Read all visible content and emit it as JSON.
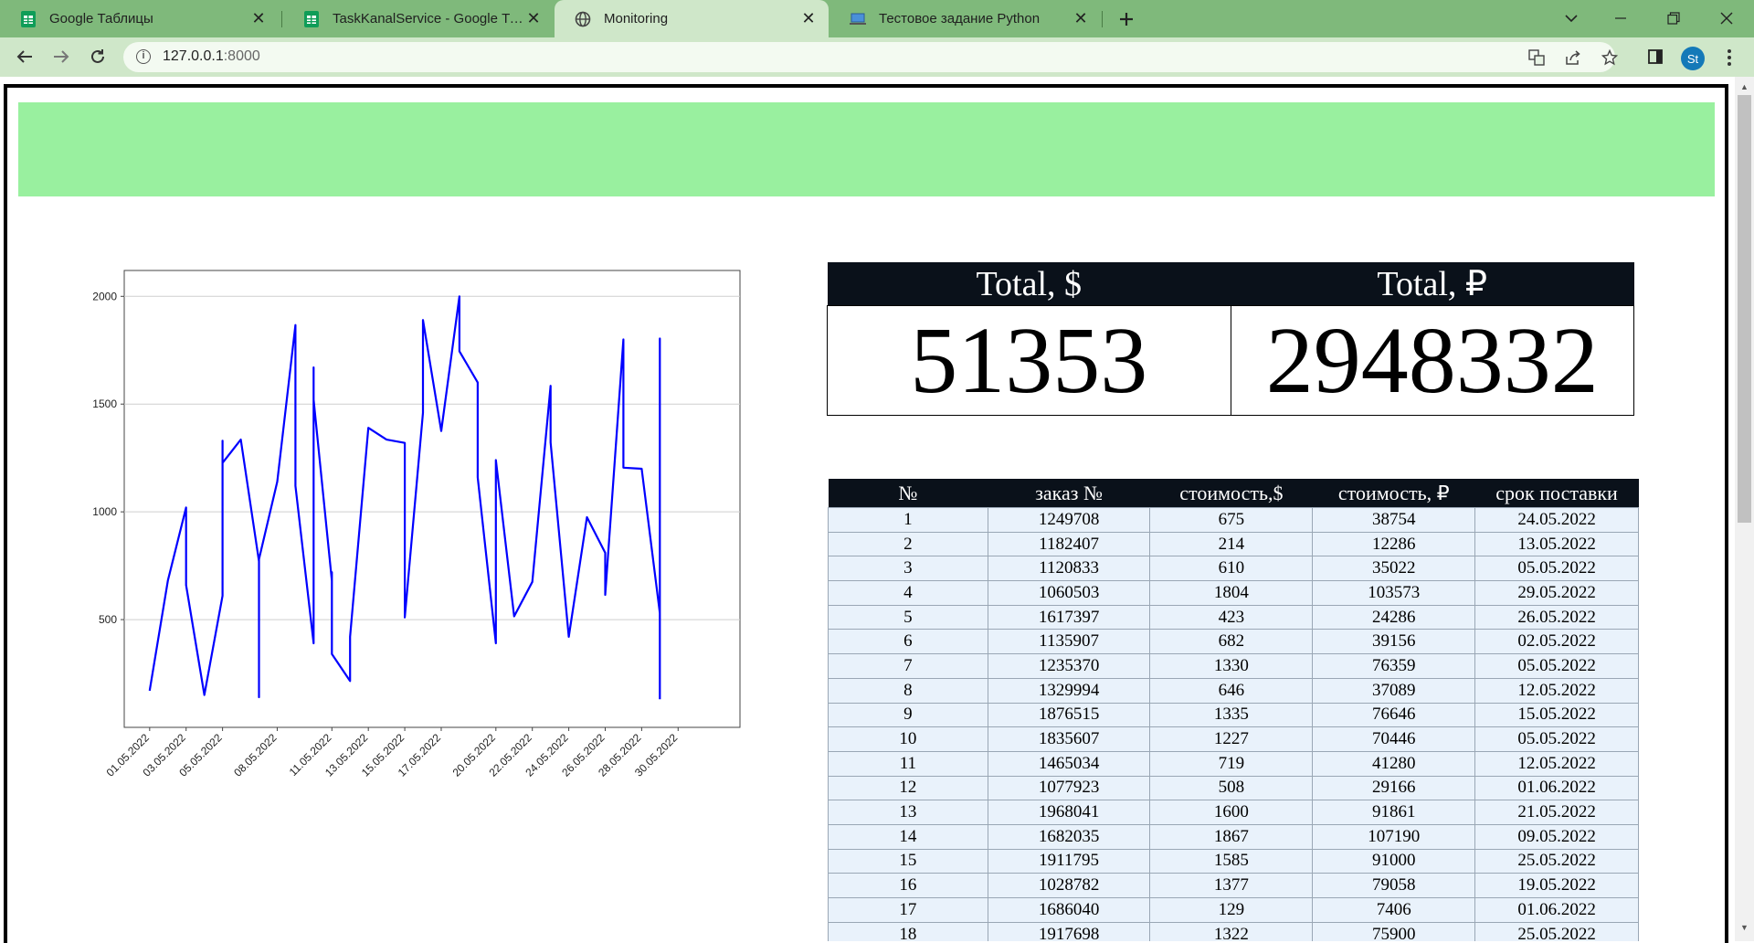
{
  "browser": {
    "tabs": [
      {
        "title": "Google Таблицы",
        "icon": "google-sheets-icon",
        "active": false
      },
      {
        "title": "TaskKanalService - Google Табли",
        "icon": "google-sheets-icon",
        "active": false
      },
      {
        "title": "Monitoring",
        "icon": "globe-icon",
        "active": true
      },
      {
        "title": "Тестовое задание Python",
        "icon": "laptop-icon",
        "active": false
      }
    ],
    "close_glyph": "✕",
    "address": {
      "host": "127.0.0.1",
      "port": ":8000"
    },
    "profile_initials": "St"
  },
  "totals": {
    "usd_label": "Total, $",
    "rub_label": "Total, ₽",
    "usd_value": "51353",
    "rub_value": "2948332"
  },
  "orders": {
    "headers": [
      "№",
      "заказ №",
      "стоимость,$",
      "стоимость, ₽",
      "срок поставки"
    ],
    "rows": [
      [
        "1",
        "1249708",
        "675",
        "38754",
        "24.05.2022"
      ],
      [
        "2",
        "1182407",
        "214",
        "12286",
        "13.05.2022"
      ],
      [
        "3",
        "1120833",
        "610",
        "35022",
        "05.05.2022"
      ],
      [
        "4",
        "1060503",
        "1804",
        "103573",
        "29.05.2022"
      ],
      [
        "5",
        "1617397",
        "423",
        "24286",
        "26.05.2022"
      ],
      [
        "6",
        "1135907",
        "682",
        "39156",
        "02.05.2022"
      ],
      [
        "7",
        "1235370",
        "1330",
        "76359",
        "05.05.2022"
      ],
      [
        "8",
        "1329994",
        "646",
        "37089",
        "12.05.2022"
      ],
      [
        "9",
        "1876515",
        "1335",
        "76646",
        "15.05.2022"
      ],
      [
        "10",
        "1835607",
        "1227",
        "70446",
        "05.05.2022"
      ],
      [
        "11",
        "1465034",
        "719",
        "41280",
        "12.05.2022"
      ],
      [
        "12",
        "1077923",
        "508",
        "29166",
        "01.06.2022"
      ],
      [
        "13",
        "1968041",
        "1600",
        "91861",
        "21.05.2022"
      ],
      [
        "14",
        "1682035",
        "1867",
        "107190",
        "09.05.2022"
      ],
      [
        "15",
        "1911795",
        "1585",
        "91000",
        "25.05.2022"
      ],
      [
        "16",
        "1028782",
        "1377",
        "79058",
        "19.05.2022"
      ],
      [
        "17",
        "1686040",
        "129",
        "7406",
        "01.06.2022"
      ],
      [
        "18",
        "1917698",
        "1322",
        "75900",
        "25.05.2022"
      ]
    ]
  },
  "chart_data": {
    "type": "line",
    "color": "#0000ff",
    "title": "",
    "xlabel": "",
    "ylabel": "",
    "grid": "horizontal",
    "x_range": [
      "01.05.2022",
      "01.06.2022"
    ],
    "ylim": [
      0,
      2000
    ],
    "yticks": [
      500,
      1000,
      1500,
      2000
    ],
    "xticks": [
      "01.05.2022",
      "03.05.2022",
      "05.05.2022",
      "08.05.2022",
      "11.05.2022",
      "13.05.2022",
      "15.05.2022",
      "17.05.2022",
      "20.05.2022",
      "22.05.2022",
      "24.05.2022",
      "26.05.2022",
      "28.05.2022",
      "30.05.2022"
    ],
    "points": [
      [
        "01.05.2022",
        170
      ],
      [
        "02.05.2022",
        682
      ],
      [
        "03.05.2022",
        1020
      ],
      [
        "03.05.2022",
        660
      ],
      [
        "04.05.2022",
        150
      ],
      [
        "05.05.2022",
        610
      ],
      [
        "05.05.2022",
        1330
      ],
      [
        "05.05.2022",
        1227
      ],
      [
        "06.05.2022",
        1335
      ],
      [
        "07.05.2022",
        770
      ],
      [
        "07.05.2022",
        140
      ],
      [
        "07.05.2022",
        780
      ],
      [
        "08.05.2022",
        1140
      ],
      [
        "09.05.2022",
        1867
      ],
      [
        "09.05.2022",
        1120
      ],
      [
        "10.05.2022",
        390
      ],
      [
        "10.05.2022",
        1670
      ],
      [
        "10.05.2022",
        1520
      ],
      [
        "11.05.2022",
        680
      ],
      [
        "11.05.2022",
        720
      ],
      [
        "11.05.2022",
        340
      ],
      [
        "12.05.2022",
        215
      ],
      [
        "12.05.2022",
        420
      ],
      [
        "13.05.2022",
        1390
      ],
      [
        "14.05.2022",
        1335
      ],
      [
        "15.05.2022",
        1320
      ],
      [
        "15.05.2022",
        510
      ],
      [
        "16.05.2022",
        1460
      ],
      [
        "16.05.2022",
        1890
      ],
      [
        "17.05.2022",
        1375
      ],
      [
        "18.05.2022",
        2000
      ],
      [
        "18.05.2022",
        1745
      ],
      [
        "19.05.2022",
        1600
      ],
      [
        "19.05.2022",
        1160
      ],
      [
        "20.05.2022",
        390
      ],
      [
        "20.05.2022",
        1240
      ],
      [
        "21.05.2022",
        515
      ],
      [
        "22.05.2022",
        675
      ],
      [
        "23.05.2022",
        1585
      ],
      [
        "23.05.2022",
        1322
      ],
      [
        "24.05.2022",
        420
      ],
      [
        "25.05.2022",
        975
      ],
      [
        "26.05.2022",
        810
      ],
      [
        "26.05.2022",
        615
      ],
      [
        "27.05.2022",
        1800
      ],
      [
        "27.05.2022",
        1205
      ],
      [
        "28.05.2022",
        1200
      ],
      [
        "29.05.2022",
        530
      ],
      [
        "29.05.2022",
        1804
      ],
      [
        "29.05.2022",
        130
      ]
    ]
  }
}
